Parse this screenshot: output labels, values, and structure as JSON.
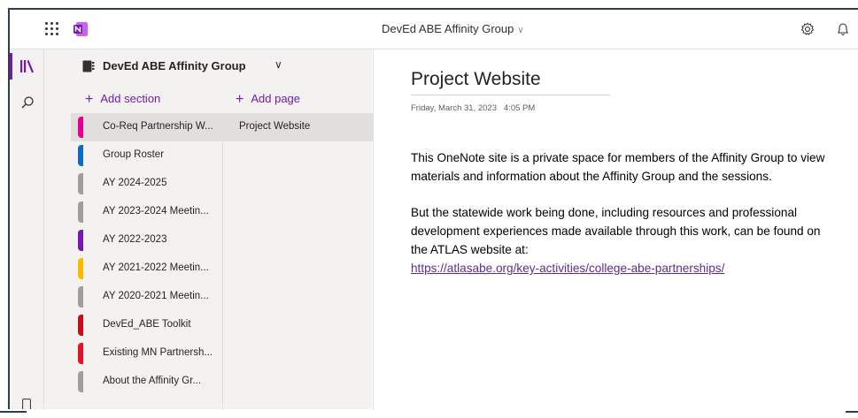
{
  "app": {
    "title": "DevEd ABE Affinity Group",
    "title_chevron": "∨",
    "icons": [
      "app-launcher-icon",
      "onenote-logo-icon",
      "settings-icon",
      "bell-icon"
    ]
  },
  "rail": {
    "icons": [
      "notebooks-icon",
      "search-icon",
      "device-icon"
    ]
  },
  "notebook": {
    "name": "DevEd ABE Affinity Group",
    "chevron": "∨",
    "add_section_label": "Add section",
    "add_page_label": "Add page",
    "plus": "+",
    "sections": [
      {
        "label": "Co-Req Partnership W...",
        "color": "#e3008c"
      },
      {
        "label": "Group Roster",
        "color": "#0f6cbd"
      },
      {
        "label": "AY 2024-2025",
        "color": "#a19f9d"
      },
      {
        "label": "AY 2023-2024 Meetin...",
        "color": "#a19f9d"
      },
      {
        "label": "AY 2022-2023",
        "color": "#7719aa"
      },
      {
        "label": "AY 2021-2022 Meetin...",
        "color": "#ffb900"
      },
      {
        "label": "AY 2020-2021 Meetin...",
        "color": "#a19f9d"
      },
      {
        "label": "DevEd_ABE Toolkit",
        "color": "#c50f1f"
      },
      {
        "label": "Existing MN Partnersh...",
        "color": "#e81123"
      },
      {
        "label": "About the Affinity Gr...",
        "color": "#a19f9d"
      }
    ],
    "pages": [
      {
        "label": "Project Website"
      }
    ]
  },
  "page": {
    "title": "Project Website",
    "date": "Friday, March 31, 2023",
    "time": "4:05 PM",
    "paragraph1": "This OneNote site is a private space for members of the Affinity Group to view materials and information about the Affinity Group and the sessions.",
    "paragraph2": "But the statewide work being done, including resources and professional development experiences made available through this work, can be found on the ATLAS website at:",
    "link": "https://atlasabe.org/key-activities/college-abe-partnerships/"
  },
  "colors": {
    "accent": "#7719aa",
    "link": "#5c2d91",
    "panel_bg": "#f3f2f1",
    "selected_bg": "#e1dfdd"
  }
}
